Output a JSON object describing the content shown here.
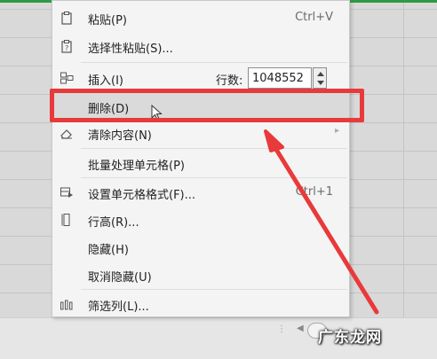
{
  "menu": {
    "paste": {
      "label": "粘贴(P)",
      "shortcut": "Ctrl+V"
    },
    "paste_special": {
      "label": "选择性粘贴(S)..."
    },
    "insert": {
      "label": "插入(I)",
      "rows_label": "行数:",
      "rows_value": "1048552"
    },
    "delete": {
      "label": "删除(D)"
    },
    "clear": {
      "label": "清除内容(N)"
    },
    "batch": {
      "label": "批量处理单元格(P)"
    },
    "format_cells": {
      "label": "设置单元格格式(F)...",
      "shortcut": "Ctrl+1"
    },
    "row_height": {
      "label": "行高(R)..."
    },
    "hide": {
      "label": "隐藏(H)"
    },
    "unhide": {
      "label": "取消隐藏(U)"
    },
    "filter_columns": {
      "label": "筛选列(L)..."
    }
  },
  "annotation": {
    "highlight_color": "#e83a3a"
  },
  "watermark": {
    "text": "广东龙网"
  },
  "colors": {
    "menu_bg": "#f4f4f4",
    "highlight_row": "#dadada",
    "sheet_green": "#2e9a45"
  }
}
